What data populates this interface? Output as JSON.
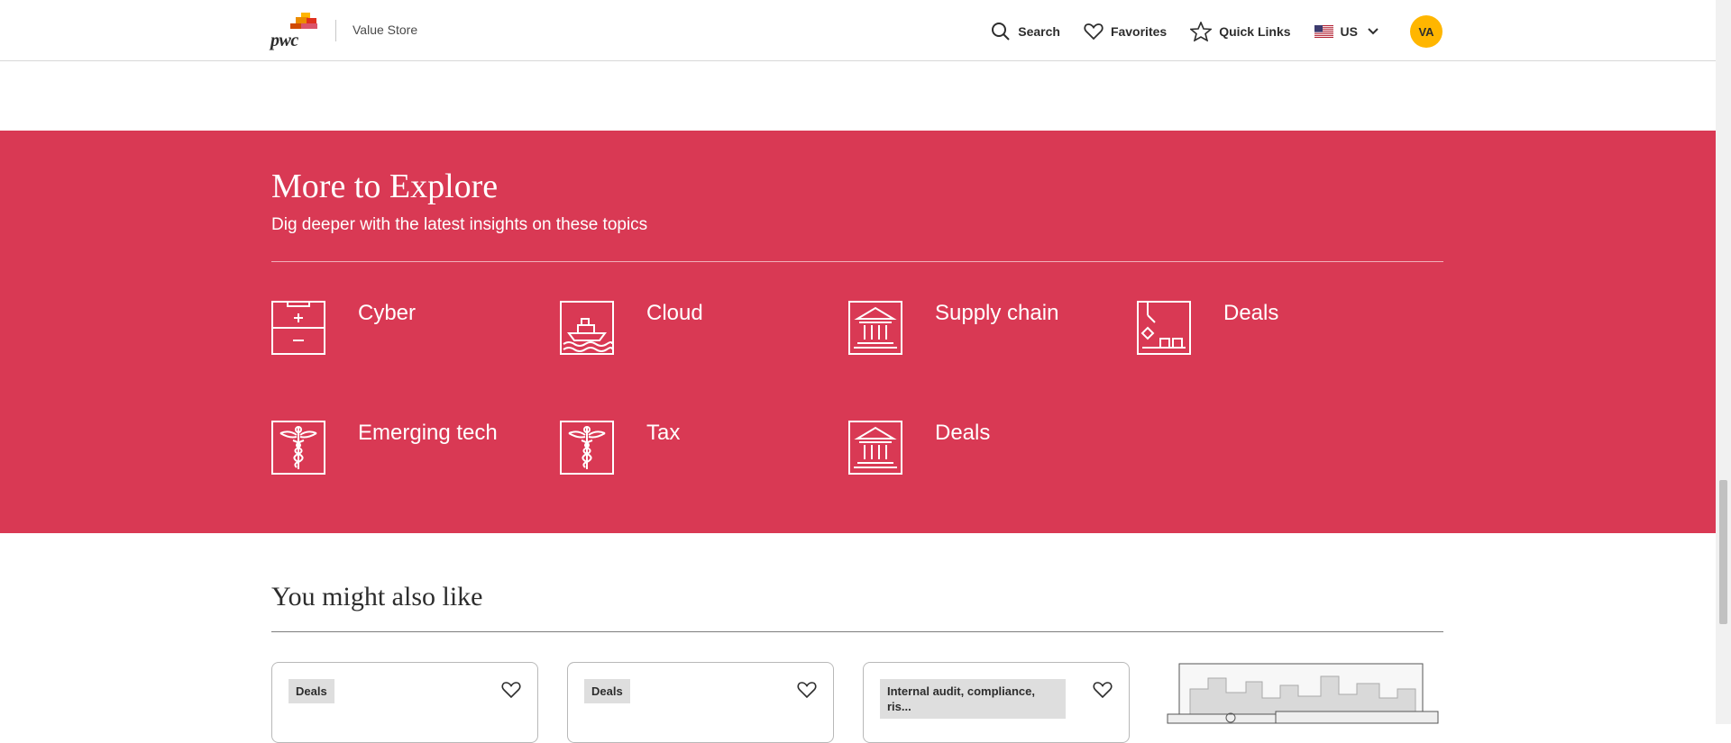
{
  "header": {
    "logo_text": "pwc",
    "app_name": "Value Store",
    "nav": {
      "search": "Search",
      "favorites": "Favorites",
      "quick_links": "Quick Links",
      "region": "US"
    },
    "avatar_initials": "VA"
  },
  "explore": {
    "title": "More to Explore",
    "subtitle": "Dig deeper with the latest insights on these topics",
    "topics": [
      {
        "label": "Cyber",
        "icon": "first-aid-kit-icon"
      },
      {
        "label": "Cloud",
        "icon": "ship-icon"
      },
      {
        "label": "Supply chain",
        "icon": "bank-building-icon"
      },
      {
        "label": "Deals",
        "icon": "crane-boxes-icon"
      },
      {
        "label": "Emerging tech",
        "icon": "caduceus-icon"
      },
      {
        "label": "Tax",
        "icon": "caduceus-icon"
      },
      {
        "label": "Deals",
        "icon": "bank-building-icon"
      }
    ]
  },
  "recommended": {
    "title": "You might also like",
    "cards": [
      {
        "tag": "Deals"
      },
      {
        "tag": "Deals"
      },
      {
        "tag": "Internal audit, compliance, ris..."
      }
    ]
  },
  "colors": {
    "explore_bg": "#d93954",
    "avatar_bg": "#ffb600",
    "tag_bg": "#dedede"
  }
}
